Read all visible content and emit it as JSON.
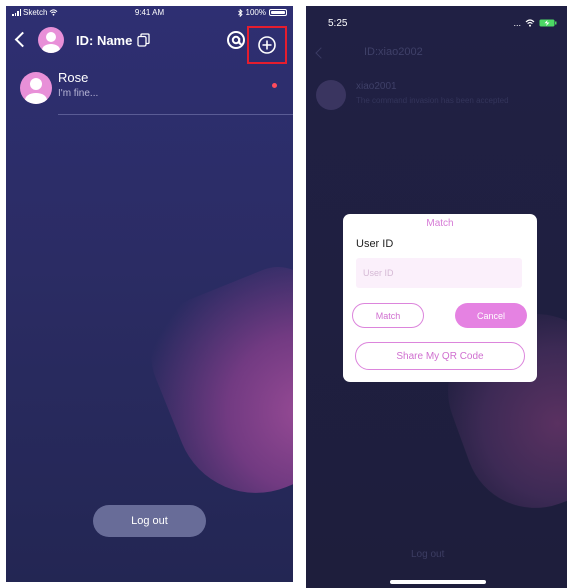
{
  "left_screen": {
    "status": {
      "carrier": "Sketch",
      "time": "9:41 AM",
      "battery": "100%"
    },
    "header": {
      "title": "ID: Name"
    },
    "chat_list": [
      {
        "name": "Rose",
        "preview": "I'm fine..."
      }
    ],
    "logout_label": "Log out"
  },
  "right_screen": {
    "status": {
      "time": "5:25",
      "extra": "..."
    },
    "background": {
      "title": "ID:xiao2002",
      "chat_name": "xiao2001",
      "chat_message": "The command invasion has been accepted",
      "logout_label": "Log out"
    },
    "dialog": {
      "title": "Match",
      "field_label": "User ID",
      "field_placeholder": "User ID",
      "field_value": "",
      "match_label": "Match",
      "cancel_label": "Cancel",
      "qr_label": "Share My QR Code"
    }
  },
  "colors": {
    "accent": "#e582e2",
    "highlight_box": "#e51d2e",
    "unread_dot": "#ff4b5c"
  }
}
